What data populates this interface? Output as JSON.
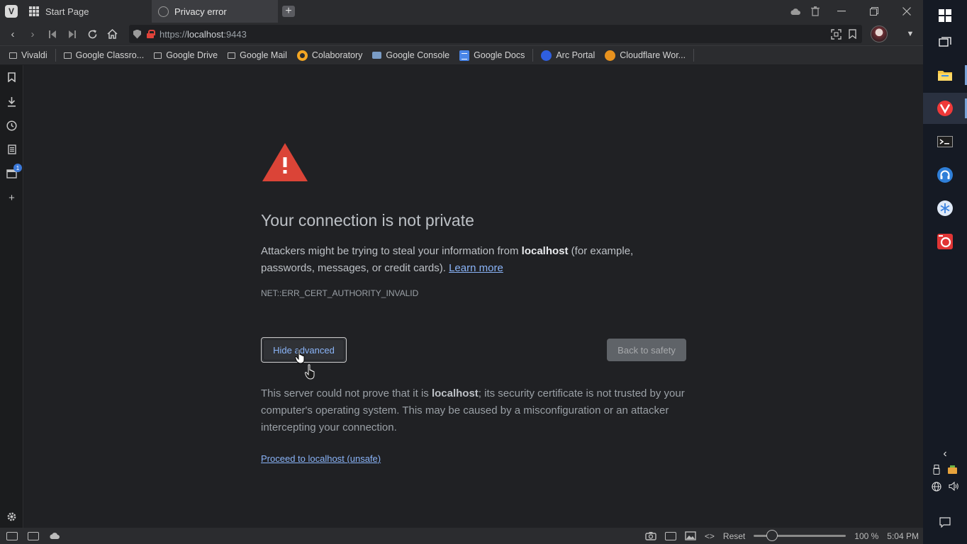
{
  "tabs": [
    {
      "label": "Start Page",
      "icon": "speed-dial-grid-icon"
    },
    {
      "label": "Privacy error",
      "icon": "globe-icon",
      "active": true
    }
  ],
  "address": {
    "scheme": "https://",
    "host": "localhost",
    "port": ":9443"
  },
  "bookmarks": [
    {
      "label": "Vivaldi",
      "icon": "folder-icon"
    },
    {
      "label": "Google Classro...",
      "icon": "folder-icon"
    },
    {
      "label": "Google Drive",
      "icon": "folder-icon"
    },
    {
      "label": "Google Mail",
      "icon": "folder-icon"
    },
    {
      "label": "Colaboratory",
      "icon": "colab-icon"
    },
    {
      "label": "Google Console",
      "icon": "console-icon"
    },
    {
      "label": "Google Docs",
      "icon": "docs-icon"
    },
    {
      "label": "Arc Portal",
      "icon": "arc-icon"
    },
    {
      "label": "Cloudflare Wor...",
      "icon": "cloudflare-icon"
    }
  ],
  "sidepanel": {
    "tabs_badge": "1"
  },
  "error": {
    "title": "Your connection is not private",
    "desc_prefix": "Attackers might be trying to steal your information from ",
    "desc_host": "localhost",
    "desc_suffix": " (for example, passwords, messages, or credit cards). ",
    "learn_more": "Learn more",
    "code": "NET::ERR_CERT_AUTHORITY_INVALID",
    "hide_advanced": "Hide advanced",
    "back_to_safety": "Back to safety",
    "details_prefix": "This server could not prove that it is ",
    "details_host": "localhost",
    "details_suffix": "; its security certificate is not trusted by your computer's operating system. This may be caused by a misconfiguration or an attacker intercepting your connection.",
    "proceed": "Proceed to localhost (unsafe)"
  },
  "statusbar": {
    "reset": "Reset",
    "zoom": "100 %",
    "zoom_fraction": 0.2,
    "time": "5:04 PM"
  },
  "colors": {
    "warning_red": "#db4437",
    "link_blue": "#8ab4f8",
    "background": "#202124"
  }
}
